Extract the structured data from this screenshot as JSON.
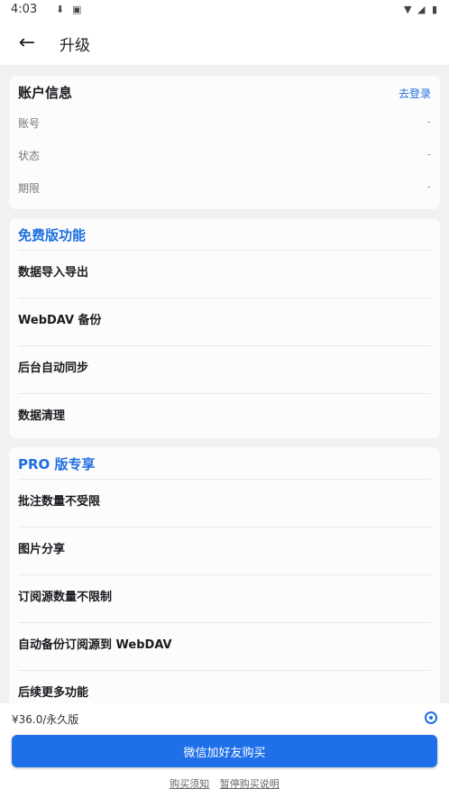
{
  "status": {
    "time": "4:03"
  },
  "app_bar": {
    "title": "升级"
  },
  "account": {
    "title": "账户信息",
    "login_label": "去登录",
    "rows": [
      {
        "label": "账号",
        "value": "-"
      },
      {
        "label": "状态",
        "value": "-"
      },
      {
        "label": "期限",
        "value": "-"
      }
    ]
  },
  "free": {
    "title": "免费版功能",
    "items": [
      "数据导入导出",
      "WebDAV 备份",
      "后台自动同步",
      "数据清理"
    ]
  },
  "pro": {
    "title": "PRO 版专享",
    "items": [
      "批注数量不受限",
      "图片分享",
      "订阅源数量不限制",
      "自动备份订阅源到 WebDAV",
      "后续更多功能"
    ]
  },
  "purchase": {
    "price": "¥36.0/永久版",
    "button_label": "微信加好友购买",
    "link_notice": "购买须知",
    "link_pause": "暂停购买说明"
  },
  "colors": {
    "accent": "#1e6fe0",
    "background": "#f1f1f4"
  }
}
